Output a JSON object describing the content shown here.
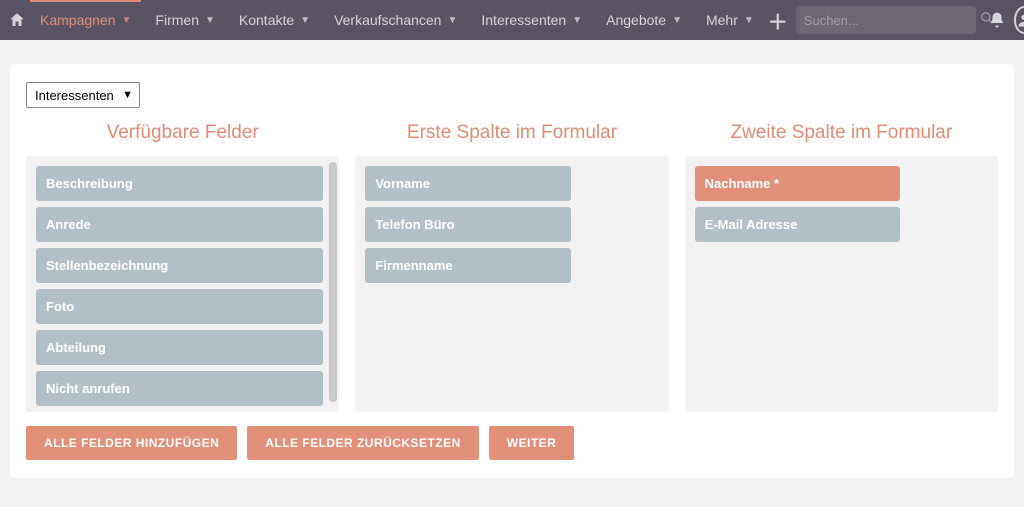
{
  "nav": {
    "items": [
      {
        "label": "Kampagnen",
        "active": true
      },
      {
        "label": "Firmen",
        "active": false
      },
      {
        "label": "Kontakte",
        "active": false
      },
      {
        "label": "Verkaufschancen",
        "active": false
      },
      {
        "label": "Interessenten",
        "active": false
      },
      {
        "label": "Angebote",
        "active": false
      },
      {
        "label": "Mehr",
        "active": false
      }
    ],
    "search_placeholder": "Suchen..."
  },
  "select": {
    "value": "Interessenten"
  },
  "columns": {
    "available": {
      "title": "Verfügbare Felder",
      "fields": [
        {
          "label": "Beschreibung"
        },
        {
          "label": "Anrede"
        },
        {
          "label": "Stellenbezeichnung"
        },
        {
          "label": "Foto"
        },
        {
          "label": "Abteilung"
        },
        {
          "label": "Nicht anrufen"
        }
      ]
    },
    "first": {
      "title": "Erste Spalte im Formular",
      "fields": [
        {
          "label": "Vorname"
        },
        {
          "label": "Telefon Büro"
        },
        {
          "label": "Firmenname"
        }
      ]
    },
    "second": {
      "title": "Zweite Spalte im Formular",
      "fields": [
        {
          "label": "Nachname *",
          "required": true
        },
        {
          "label": "E-Mail Adresse"
        }
      ]
    }
  },
  "buttons": {
    "add_all": "ALLE FELDER HINZUFÜGEN",
    "reset_all": "ALLE FELDER ZURÜCKSETZEN",
    "continue": "WEITER"
  }
}
